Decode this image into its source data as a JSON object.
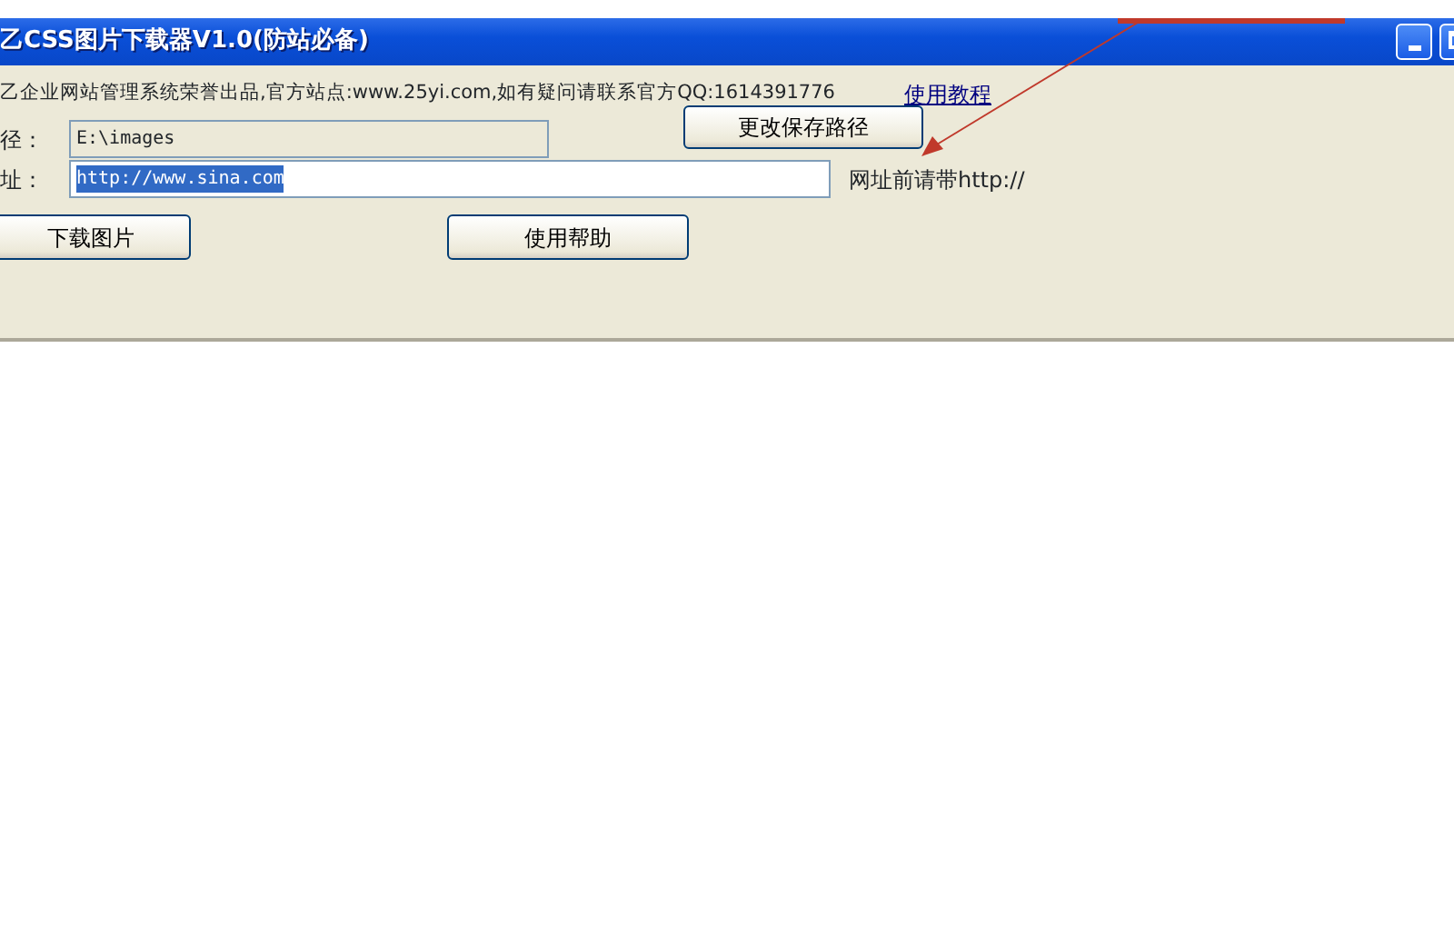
{
  "window": {
    "title": "乙CSS图片下载器V1.0(防站必备)",
    "controls": [
      {
        "kind": "minimize"
      },
      {
        "kind": "maximize"
      }
    ]
  },
  "info": {
    "text": "乙企业网站管理系统荣誉出品,官方站点:www.25yi.com,如有疑问请联系官方QQ:1614391776",
    "link": "使用教程"
  },
  "path": {
    "label": "径：",
    "value": "E:\\images",
    "disabled": true,
    "button": "更改保存路径"
  },
  "url": {
    "label": "址：",
    "value": "http://www.sina.com",
    "selected": true,
    "hint": "网址前请带http://"
  },
  "buttons": [
    "下载图片",
    "使用帮助"
  ]
}
